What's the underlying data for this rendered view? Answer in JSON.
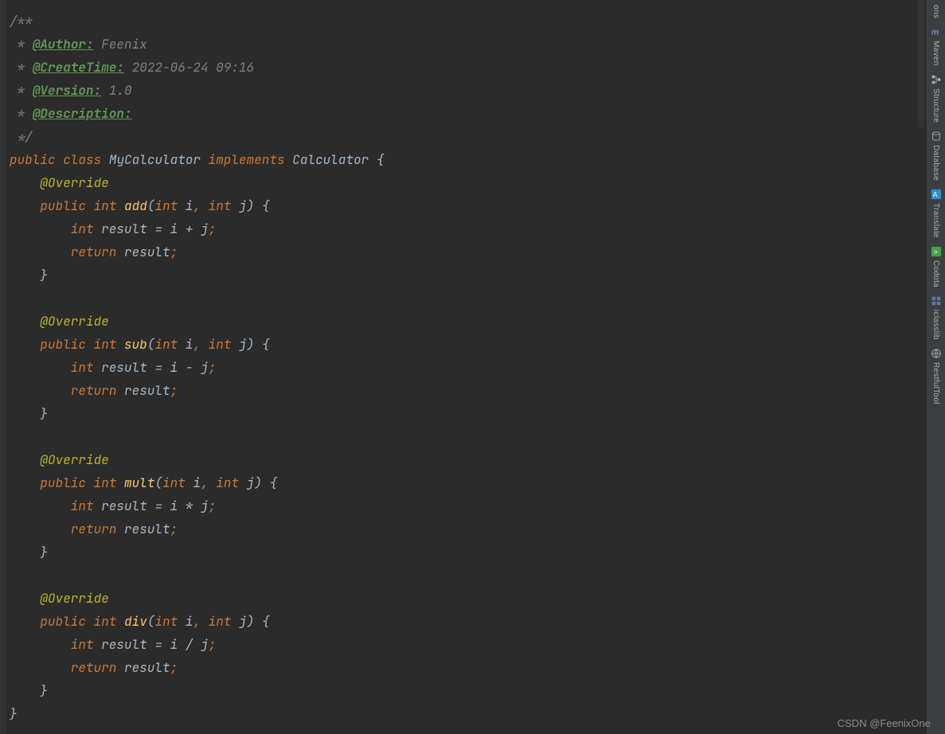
{
  "docblock": {
    "open": "/**",
    "star": " * ",
    "author_tag": "@Author:",
    "author_val": " Feenix",
    "create_tag": "@CreateTime:",
    "create_val": " 2022-06-24 09:16",
    "version_tag": "@Version:",
    "version_val": " 1.0",
    "desc_tag": "@Description:",
    "close": " */"
  },
  "code": {
    "kw_public": "public",
    "kw_class": "class",
    "class_name": "MyCalculator",
    "kw_implements": "implements",
    "iface_name": "Calculator",
    "lbrace": "{",
    "rbrace": "}",
    "override": "@Override",
    "kw_int": "int",
    "kw_return": "return",
    "m_add": "add",
    "m_sub": "sub",
    "m_mult": "mult",
    "m_div": "div",
    "p_i": "i",
    "p_j": "j",
    "v_result": "result",
    "eq": "=",
    "plus": "+",
    "minus": "-",
    "star": "*",
    "slash": "/",
    "semi": ";",
    "comma": ",",
    "lpar": "(",
    "rpar": ")"
  },
  "tools": [
    {
      "name": "ons",
      "icon": "dots"
    },
    {
      "name": "Maven",
      "icon": "maven"
    },
    {
      "name": "Structure",
      "icon": "structure"
    },
    {
      "name": "Database",
      "icon": "database"
    },
    {
      "name": "Translate",
      "icon": "translate"
    },
    {
      "name": "Codota",
      "icon": "codota"
    },
    {
      "name": "iclasslib",
      "icon": "grid"
    },
    {
      "name": "RestfulTool",
      "icon": "globe"
    }
  ],
  "watermark": "CSDN @FeenixOne"
}
